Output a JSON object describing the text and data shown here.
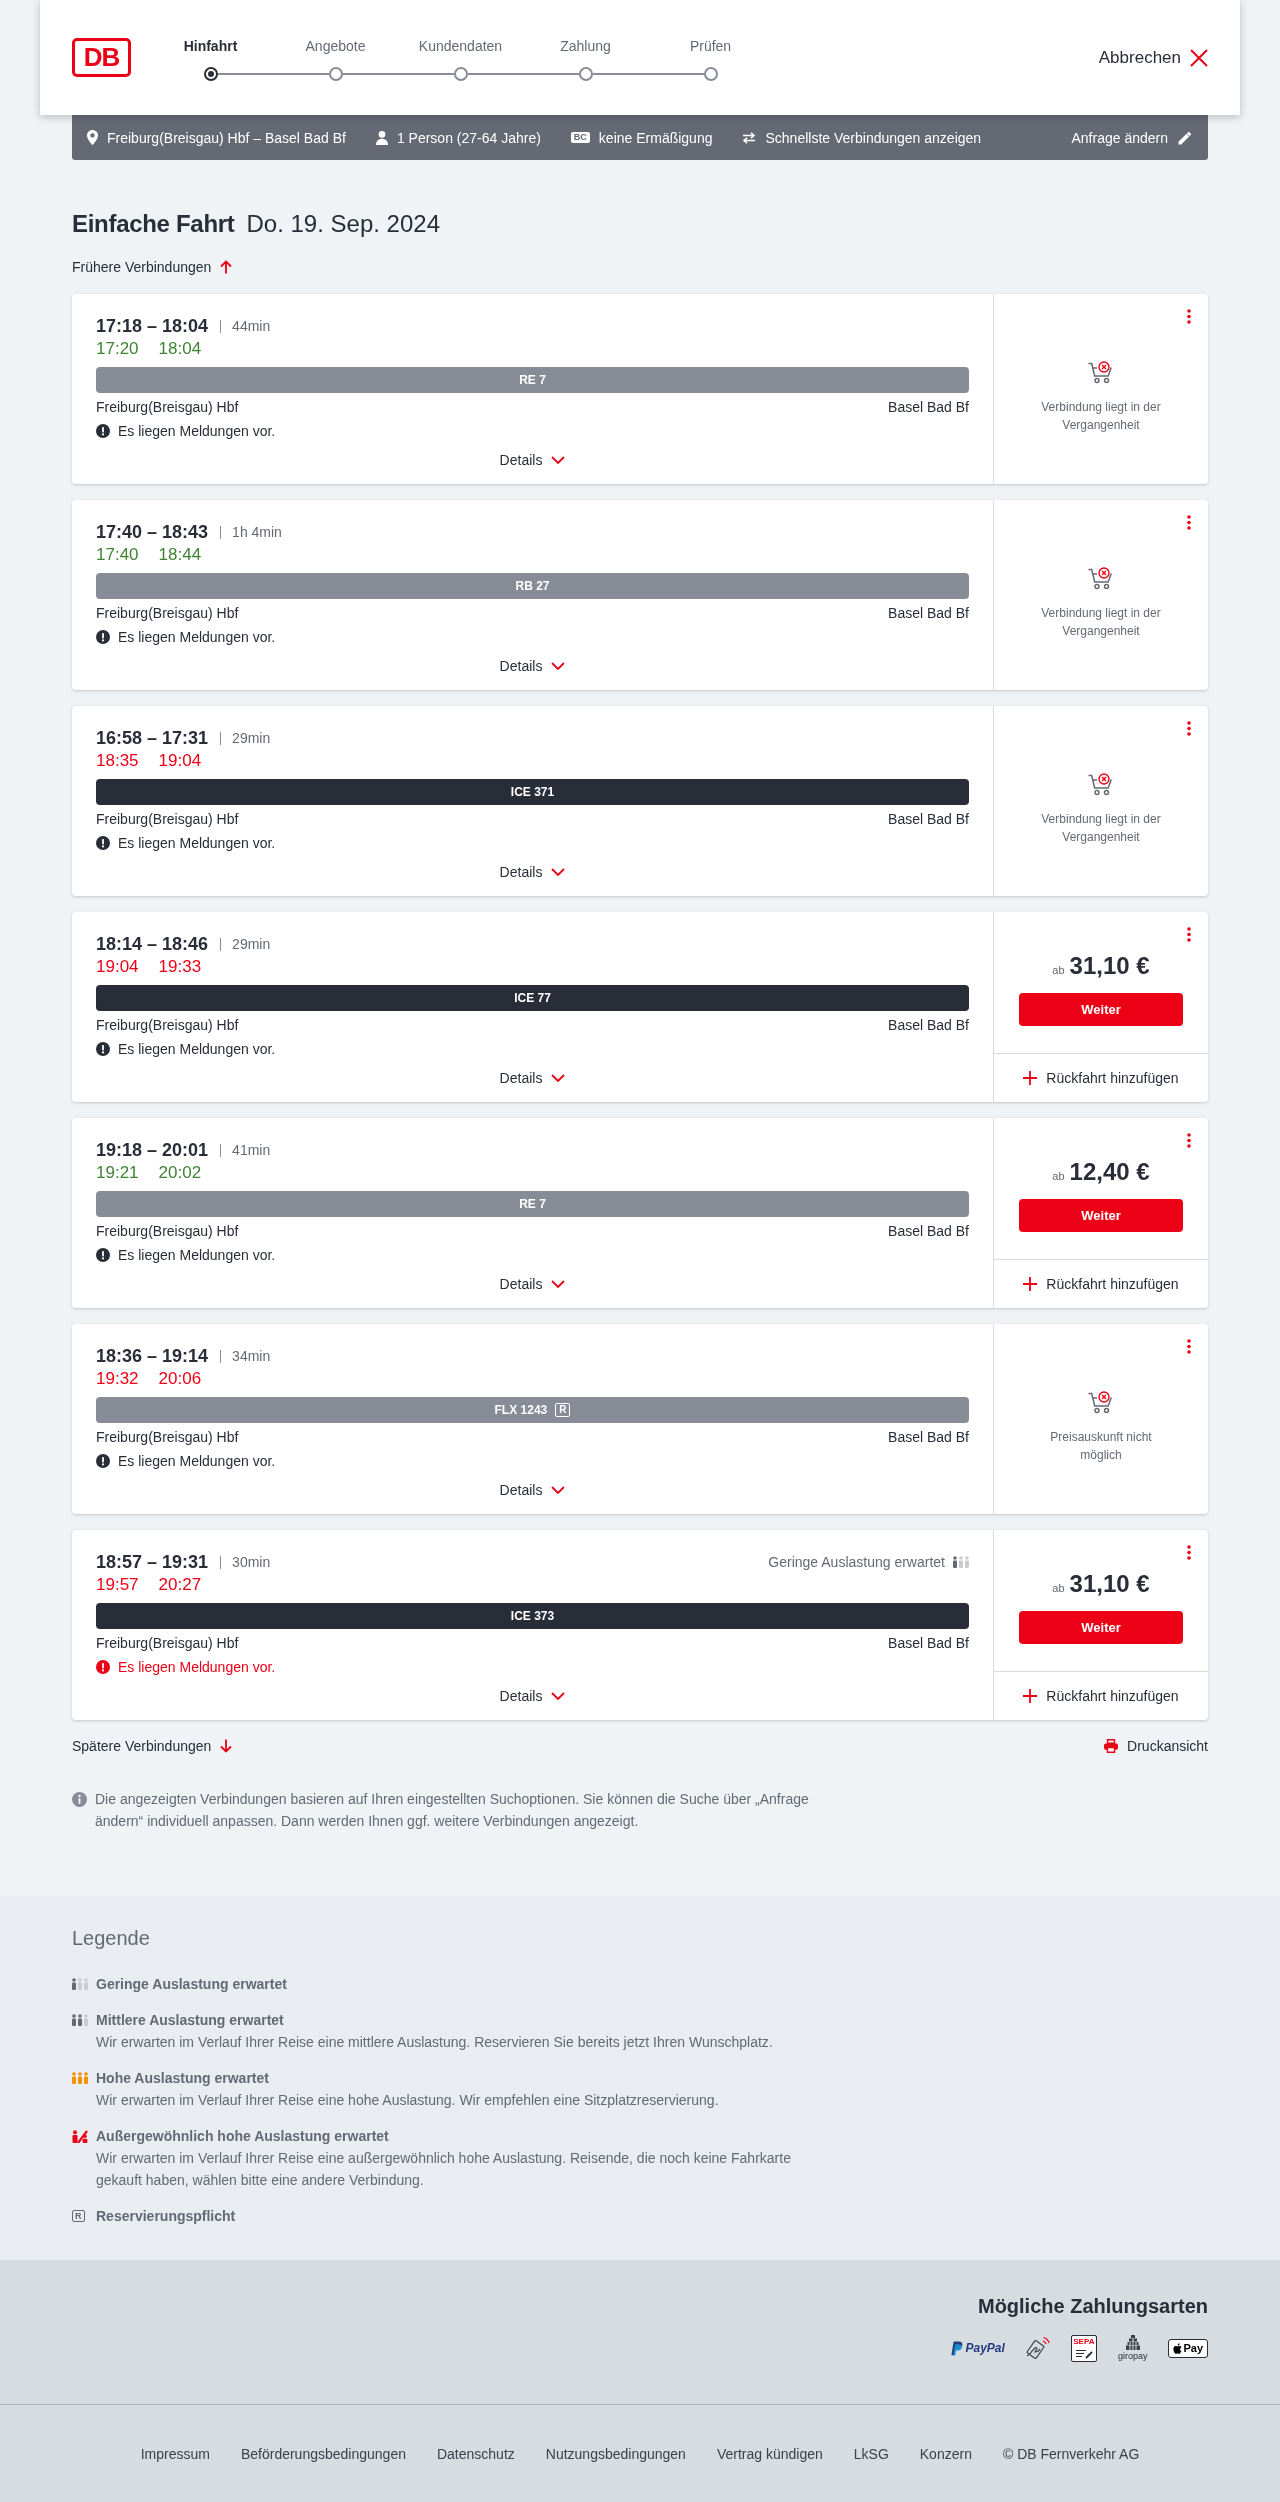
{
  "header": {
    "logo": "DB",
    "steps": [
      {
        "label": "Hinfahrt",
        "selected": true
      },
      {
        "label": "Angebote",
        "selected": false
      },
      {
        "label": "Kundendaten",
        "selected": false
      },
      {
        "label": "Zahlung",
        "selected": false
      },
      {
        "label": "Prüfen",
        "selected": false
      }
    ],
    "cancel": "Abbrechen"
  },
  "search_summary": {
    "items": [
      {
        "kind": "route",
        "text": "Freiburg(Breisgau) Hbf – Basel Bad Bf"
      },
      {
        "kind": "travellers",
        "text": "1 Person (27-64 Jahre)"
      },
      {
        "kind": "discount",
        "badge": "BC",
        "text": "keine Ermäßigung"
      },
      {
        "kind": "option",
        "text": "Schnellste Verbindungen anzeigen"
      }
    ],
    "edit": "Anfrage ändern"
  },
  "heading": {
    "trip_type": "Einfache Fahrt",
    "date": "Do. 19. Sep. 2024"
  },
  "earlier_link": "Frühere Verbindungen",
  "connections": [
    {
      "schedule": "17:18 – 18:04",
      "duration": "44min",
      "realtime": {
        "departure": "17:20",
        "arrival": "18:04"
      },
      "delayed": false,
      "train": {
        "name": "RE 7",
        "kind": "regional"
      },
      "from": "Freiburg(Breisgau) Hbf",
      "to": "Basel Bad Bf",
      "message": {
        "text": "Es liegen Meldungen vor.",
        "alert": false
      },
      "details": "Details",
      "offer": {
        "kind": "past",
        "text": "Verbindung liegt in der Vergangenheit"
      }
    },
    {
      "schedule": "17:40 – 18:43",
      "duration": "1h 4min",
      "realtime": {
        "departure": "17:40",
        "arrival": "18:44"
      },
      "delayed": false,
      "train": {
        "name": "RB 27",
        "kind": "regional"
      },
      "from": "Freiburg(Breisgau) Hbf",
      "to": "Basel Bad Bf",
      "message": {
        "text": "Es liegen Meldungen vor.",
        "alert": false
      },
      "details": "Details",
      "offer": {
        "kind": "past",
        "text": "Verbindung liegt in der Vergangenheit"
      }
    },
    {
      "schedule": "16:58 – 17:31",
      "duration": "29min",
      "realtime": {
        "departure": "18:35",
        "arrival": "19:04"
      },
      "delayed": true,
      "train": {
        "name": "ICE 371",
        "kind": "longdistance"
      },
      "from": "Freiburg(Breisgau) Hbf",
      "to": "Basel Bad Bf",
      "message": {
        "text": "Es liegen Meldungen vor.",
        "alert": false
      },
      "details": "Details",
      "offer": {
        "kind": "past",
        "text": "Verbindung liegt in der Vergangenheit"
      }
    },
    {
      "schedule": "18:14 – 18:46",
      "duration": "29min",
      "realtime": {
        "departure": "19:04",
        "arrival": "19:33"
      },
      "delayed": true,
      "train": {
        "name": "ICE 77",
        "kind": "longdistance"
      },
      "from": "Freiburg(Breisgau) Hbf",
      "to": "Basel Bad Bf",
      "message": {
        "text": "Es liegen Meldungen vor.",
        "alert": false
      },
      "details": "Details",
      "offer": {
        "kind": "price",
        "prefix": "ab",
        "price": "31,10 €",
        "button": "Weiter",
        "return_trip": "Rückfahrt hinzufügen"
      }
    },
    {
      "schedule": "19:18 – 20:01",
      "duration": "41min",
      "realtime": {
        "departure": "19:21",
        "arrival": "20:02"
      },
      "delayed": false,
      "train": {
        "name": "RE 7",
        "kind": "regional"
      },
      "from": "Freiburg(Breisgau) Hbf",
      "to": "Basel Bad Bf",
      "message": {
        "text": "Es liegen Meldungen vor.",
        "alert": false
      },
      "details": "Details",
      "offer": {
        "kind": "price",
        "prefix": "ab",
        "price": "12,40 €",
        "button": "Weiter",
        "return_trip": "Rückfahrt hinzufügen"
      }
    },
    {
      "schedule": "18:36 – 19:14",
      "duration": "34min",
      "realtime": {
        "departure": "19:32",
        "arrival": "20:06"
      },
      "delayed": true,
      "train": {
        "name": "FLX 1243",
        "kind": "regional",
        "reservation": "R"
      },
      "from": "Freiburg(Breisgau) Hbf",
      "to": "Basel Bad Bf",
      "message": {
        "text": "Es liegen Meldungen vor.",
        "alert": false
      },
      "details": "Details",
      "offer": {
        "kind": "unavailable",
        "text": "Preisauskunft nicht möglich"
      }
    },
    {
      "schedule": "18:57 – 19:31",
      "duration": "30min",
      "occupancy": {
        "kind": "low",
        "text": "Geringe Auslastung erwartet"
      },
      "realtime": {
        "departure": "19:57",
        "arrival": "20:27"
      },
      "delayed": true,
      "train": {
        "name": "ICE 373",
        "kind": "longdistance"
      },
      "from": "Freiburg(Breisgau) Hbf",
      "to": "Basel Bad Bf",
      "message": {
        "text": "Es liegen Meldungen vor.",
        "alert": true
      },
      "details": "Details",
      "offer": {
        "kind": "price",
        "prefix": "ab",
        "price": "31,10 €",
        "button": "Weiter",
        "return_trip": "Rückfahrt hinzufügen"
      }
    }
  ],
  "later_link": "Spätere Verbindungen",
  "print_link": "Druckansicht",
  "notice": "Die angezeigten Verbindungen basieren auf Ihren eingestellten Suchoptionen. Sie können die Suche über „Anfrage ändern“ individuell anpassen. Dann werden Ihnen ggf. weitere Verbindungen angezeigt.",
  "legend": {
    "title": "Legende",
    "items": [
      {
        "kind": "low",
        "title": "Geringe Auslastung erwartet"
      },
      {
        "kind": "medium",
        "title": "Mittlere Auslastung erwartet",
        "text": "Wir erwarten im Verlauf Ihrer Reise eine mittlere Auslastung. Reservieren Sie bereits jetzt Ihren Wunschplatz."
      },
      {
        "kind": "high",
        "title": "Hohe Auslastung erwartet",
        "text": "Wir erwarten im Verlauf Ihrer Reise eine hohe Auslastung. Wir empfehlen eine Sitzplatzreservierung."
      },
      {
        "kind": "exceptional",
        "title": "Außergewöhnlich hohe Auslastung erwartet",
        "text": "Wir erwarten im Verlauf Ihrer Reise eine außergewöhnlich hohe Auslastung. Reisende, die noch keine Fahrkarte gekauft haben, wählen bitte eine andere Verbindung."
      },
      {
        "kind": "reservation",
        "mark": "R",
        "title": "Reservierungspflicht"
      }
    ]
  },
  "payment": {
    "title": "Mögliche Zahlungsarten",
    "methods": [
      {
        "kind": "paypal",
        "label": "PayPal"
      },
      {
        "kind": "contactless"
      },
      {
        "kind": "sepa",
        "label": "SEPA"
      },
      {
        "kind": "giropay",
        "label": "giropay"
      },
      {
        "kind": "applepay",
        "label": "Pay"
      }
    ]
  },
  "footer": {
    "links": [
      "Impressum",
      "Beförderungsbedingungen",
      "Datenschutz",
      "Nutzungsbedingungen",
      "Vertrag kündigen",
      "LkSG",
      "Konzern"
    ],
    "copyright": "© DB Fernverkehr AG"
  }
}
